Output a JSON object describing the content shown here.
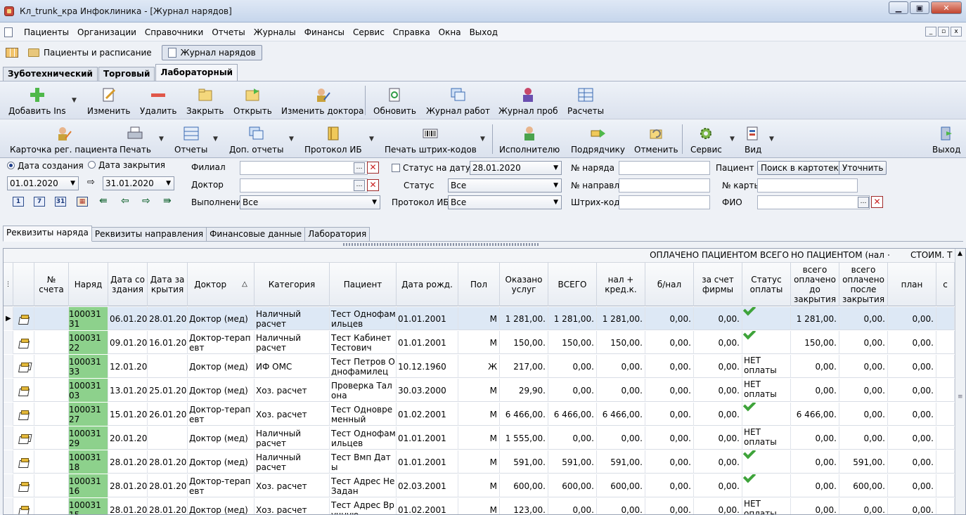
{
  "window": {
    "title": "Кл_trunk_кра Инфоклиника - [Журнал нарядов]",
    "minimize": "▁",
    "maximize": "▣",
    "close": "✕"
  },
  "menu": {
    "items": [
      "Пациенты",
      "Организации",
      "Справочники",
      "Отчеты",
      "Журналы",
      "Финансы",
      "Сервис",
      "Справка",
      "Окна",
      "Выход"
    ],
    "mdi": [
      "_",
      "▫",
      "x"
    ]
  },
  "window_tabs": [
    "Пациенты и расписание",
    "Журнал нарядов"
  ],
  "mode_tabs": [
    "Зуботехнический",
    "Торговый",
    "Лабораторный"
  ],
  "toolbar1": {
    "add": "Добавить Ins",
    "edit": "Изменить",
    "delete": "Удалить",
    "close": "Закрыть",
    "open": "Открыть",
    "change_doctor": "Изменить доктора",
    "refresh": "Обновить",
    "works_journal": "Журнал работ",
    "samples_journal": "Журнал проб",
    "calc": "Расчеты"
  },
  "toolbar2": {
    "patient_card": "Карточка рег. пациента",
    "print": "Печать",
    "reports": "Отчеты",
    "extra_reports": "Доп. отчеты",
    "protocol": "Протокол ИБ",
    "barcode": "Печать штрих-кодов",
    "executor": "Исполнителю",
    "contractor": "Подрядчику",
    "cancel": "Отменить",
    "service": "Сервис",
    "view": "Вид",
    "exit": "Выход"
  },
  "filters": {
    "date_created": "Дата создания",
    "date_closed": "Дата закрытия",
    "date_from": "01.01.2020",
    "date_to": "31.01.2020",
    "cal_btns": [
      "1",
      "7",
      "31"
    ],
    "branch_label": "Филиал",
    "doctor_label": "Доктор",
    "execution_label": "Выполнение",
    "execution_value": "Все",
    "status_on_date_label": "Статус на дату",
    "status_on_date_value": "28.01.2020",
    "status_label": "Статус",
    "status_value": "Все",
    "protocol_label": "Протокол ИБ",
    "protocol_value": "Все",
    "order_no_label": "№ наряда",
    "referral_no_label": "№ направл.",
    "barcode_label": "Штрих-код",
    "patient_label": "Пациент",
    "search_card_btn": "Поиск в картотеке",
    "refine_btn": "Уточнить",
    "card_no_label": "№ карты",
    "fio_label": "ФИО"
  },
  "detail_tabs": [
    "Реквизиты наряда",
    "Реквизиты направления",
    "Финансовые данные",
    "Лаборатория"
  ],
  "grid": {
    "bands": [
      "ОПЛАЧЕНО ПАЦИЕНТОМ ВСЕГО",
      "НО ПАЦИЕНТОМ (нал +",
      "СТОИМ. Т"
    ],
    "headers": [
      "№ счета",
      "Наряд",
      "Дата создания",
      "Дата закрытия",
      "Доктор",
      "Категория",
      "Пациент",
      "Дата рожд.",
      "Пол",
      "Оказано услуг",
      "ВСЕГО",
      "нал + кред.к.",
      "б/нал",
      "за счет фирмы",
      "Статус оплаты",
      "всего оплачено до закрытия",
      "всего оплачено после закрытия",
      "план",
      "с"
    ],
    "sort_indicator": "△",
    "rows": [
      {
        "icon": "single",
        "order": "10003131",
        "created": "06.01.20",
        "closed": "28.01.20",
        "doctor": "Доктор (мед)",
        "category": "Наличный расчет",
        "patient": "Тест Однофамильцев",
        "birth": "01.01.2001",
        "sex": "М",
        "services": "1 281,00.",
        "total": "1 281,00.",
        "cash": "1 281,00.",
        "noncash": "0,00.",
        "firm": "0,00.",
        "status": "ok",
        "paid_before": "1 281,00.",
        "paid_after": "0,00.",
        "plan": "0,00."
      },
      {
        "icon": "single",
        "order": "10003122",
        "created": "09.01.20",
        "closed": "16.01.20",
        "doctor": "Доктор-терапевт",
        "category": "Наличный расчет",
        "patient": "Тест Кабинет Тестович",
        "birth": "01.01.2001",
        "sex": "М",
        "services": "150,00.",
        "total": "150,00.",
        "cash": "150,00.",
        "noncash": "0,00.",
        "firm": "0,00.",
        "status": "ok",
        "paid_before": "150,00.",
        "paid_after": "0,00.",
        "plan": "0,00."
      },
      {
        "icon": "multi",
        "order": "10003133",
        "created": "12.01.20",
        "closed": "",
        "doctor": "Доктор (мед)",
        "category": "ИФ ОМС",
        "patient": "Тест Петров Однофамилец",
        "birth": "10.12.1960",
        "sex": "Ж",
        "services": "217,00.",
        "total": "0,00.",
        "cash": "0,00.",
        "noncash": "0,00.",
        "firm": "0,00.",
        "status": "НЕТ оплаты",
        "paid_before": "0,00.",
        "paid_after": "0,00.",
        "plan": "0,00."
      },
      {
        "icon": "plus",
        "order": "10003103",
        "created": "13.01.20",
        "closed": "25.01.20",
        "doctor": "Доктор (мед)",
        "category": "Хоз. расчет",
        "patient": "Проверка Талона",
        "birth": "30.03.2000",
        "sex": "М",
        "services": "29,90.",
        "total": "0,00.",
        "cash": "0,00.",
        "noncash": "0,00.",
        "firm": "0,00.",
        "status": "НЕТ оплаты",
        "paid_before": "0,00.",
        "paid_after": "0,00.",
        "plan": "0,00."
      },
      {
        "icon": "plus",
        "order": "10003127",
        "created": "15.01.20",
        "closed": "26.01.20",
        "doctor": "Доктор-терапевт",
        "category": "Хоз. расчет",
        "patient": "Тест Одновременный",
        "birth": "01.02.2001",
        "sex": "М",
        "services": "6 466,00.",
        "total": "6 466,00.",
        "cash": "6 466,00.",
        "noncash": "0,00.",
        "firm": "0,00.",
        "status": "ok",
        "paid_before": "6 466,00.",
        "paid_after": "0,00.",
        "plan": "0,00."
      },
      {
        "icon": "multi",
        "order": "10003129",
        "created": "20.01.20",
        "closed": "",
        "doctor": "Доктор (мед)",
        "category": "Наличный расчет",
        "patient": "Тест Однофамильцев",
        "birth": "01.01.2001",
        "sex": "М",
        "services": "1 555,00.",
        "total": "0,00.",
        "cash": "0,00.",
        "noncash": "0,00.",
        "firm": "0,00.",
        "status": "НЕТ оплаты",
        "paid_before": "0,00.",
        "paid_after": "0,00.",
        "plan": "0,00."
      },
      {
        "icon": "plus",
        "order": "10003118",
        "created": "28.01.20",
        "closed": "28.01.20",
        "doctor": "Доктор (мед)",
        "category": "Наличный расчет",
        "patient": "Тест Вмп Даты",
        "birth": "01.01.2001",
        "sex": "М",
        "services": "591,00.",
        "total": "591,00.",
        "cash": "591,00.",
        "noncash": "0,00.",
        "firm": "0,00.",
        "status": "ok",
        "paid_before": "0,00.",
        "paid_after": "591,00.",
        "plan": "0,00."
      },
      {
        "icon": "plus",
        "order": "10003116",
        "created": "28.01.20",
        "closed": "28.01.20",
        "doctor": "Доктор-терапевт",
        "category": "Хоз. расчет",
        "patient": "Тест Адрес Не Задан",
        "birth": "02.03.2001",
        "sex": "М",
        "services": "600,00.",
        "total": "600,00.",
        "cash": "600,00.",
        "noncash": "0,00.",
        "firm": "0,00.",
        "status": "ok",
        "paid_before": "0,00.",
        "paid_after": "600,00.",
        "plan": "0,00."
      },
      {
        "icon": "plus",
        "order": "10003115",
        "created": "28.01.20",
        "closed": "28.01.20",
        "doctor": "Доктор (мед)",
        "category": "Хоз. расчет",
        "patient": "Тест Адрес Вручную",
        "birth": "01.02.2001",
        "sex": "М",
        "services": "123,00.",
        "total": "0,00.",
        "cash": "0,00.",
        "noncash": "0,00.",
        "firm": "0,00.",
        "status": "НЕТ оплаты",
        "paid_before": "0,00.",
        "paid_after": "0,00.",
        "plan": "0,00."
      }
    ]
  },
  "colors": {
    "order_cell": "#8dd18c",
    "selected_row": "#dde8f5",
    "paid_tick": "#3ea33a"
  }
}
